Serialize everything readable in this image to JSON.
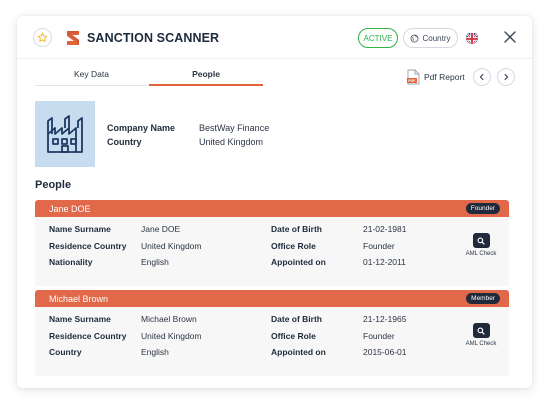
{
  "header": {
    "logo_text": "SANCTION SCANNER",
    "status_badge": "ACTIVE",
    "country_button": "Country",
    "colors": {
      "accent": "#e0633a",
      "active": "#2fb34b",
      "dark": "#202a3a"
    }
  },
  "tabs": [
    {
      "label": "Key Data",
      "active": false
    },
    {
      "label": "People",
      "active": true
    }
  ],
  "toolbar": {
    "pdf_report": "Pdf Report"
  },
  "company": {
    "fields": [
      {
        "label": "Company Name",
        "value": "BestWay Finance"
      },
      {
        "label": "Country",
        "value": "United Kingdom"
      }
    ]
  },
  "people_heading": "People",
  "people": [
    {
      "name": "Jane DOE",
      "role": "Founder",
      "left": [
        {
          "label": "Name Surname",
          "value": "Jane DOE"
        },
        {
          "label": "Residence Country",
          "value": "United Kingdom"
        },
        {
          "label": "Nationality",
          "value": "English"
        }
      ],
      "right": [
        {
          "label": "Date of Birth",
          "value": "21-02-1981"
        },
        {
          "label": "Office Role",
          "value": "Founder"
        },
        {
          "label": "Appointed on",
          "value": "01-12-2011"
        }
      ],
      "aml_label": "AML Check"
    },
    {
      "name": "Michael Brown",
      "role": "Member",
      "left": [
        {
          "label": "Name Surname",
          "value": "Michael Brown"
        },
        {
          "label": "Residence Country",
          "value": "United Kingdom"
        },
        {
          "label": "Country",
          "value": "English"
        }
      ],
      "right": [
        {
          "label": "Date of Birth",
          "value": "21-12-1965"
        },
        {
          "label": "Office Role",
          "value": "Founder"
        },
        {
          "label": "Appointed on",
          "value": "2015-06-01"
        }
      ],
      "aml_label": "AML Check"
    }
  ]
}
